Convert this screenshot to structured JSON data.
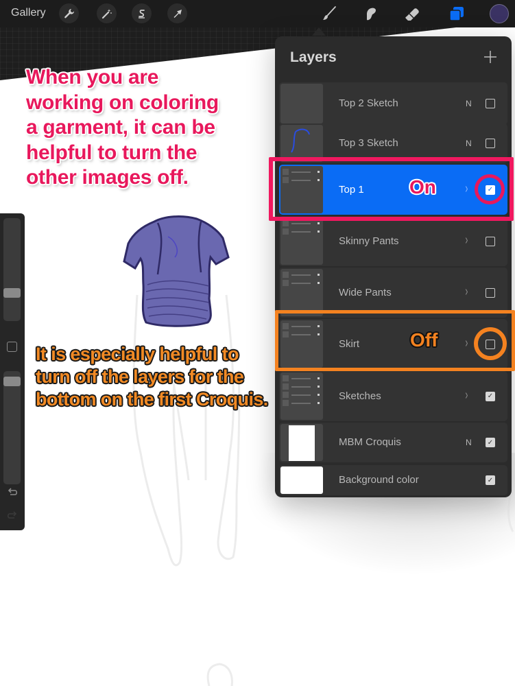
{
  "toolbar": {
    "gallery_label": "Gallery",
    "left_tools": [
      {
        "name": "actions",
        "icon": "wrench-icon"
      },
      {
        "name": "adjustments",
        "icon": "magic-wand-icon"
      },
      {
        "name": "selection",
        "icon": "selection-s-icon"
      },
      {
        "name": "transform",
        "icon": "arrow-cursor-icon"
      }
    ],
    "right_tools": [
      {
        "name": "brush",
        "icon": "brush-icon"
      },
      {
        "name": "smudge",
        "icon": "smudge-icon"
      },
      {
        "name": "eraser",
        "icon": "eraser-icon"
      },
      {
        "name": "layers",
        "icon": "layers-icon",
        "active": true
      }
    ],
    "active_color": "#3a3263",
    "accent_color": "#0a6cf5"
  },
  "sidebar": {
    "brush_size_level": 0.25,
    "opacity_level": 0.95
  },
  "layers_panel": {
    "title": "Layers",
    "add_label": "+",
    "layers": [
      {
        "name": "Top 2 Sketch",
        "blend": "N",
        "visible": false,
        "group": false,
        "selected": false
      },
      {
        "name": "Top 3 Sketch",
        "blend": "N",
        "visible": false,
        "group": false,
        "selected": false
      },
      {
        "name": "Top 1",
        "blend": "",
        "visible": true,
        "group": true,
        "selected": true
      },
      {
        "name": "Skinny Pants",
        "blend": "",
        "visible": false,
        "group": true,
        "selected": false
      },
      {
        "name": "Wide Pants",
        "blend": "",
        "visible": false,
        "group": true,
        "selected": false
      },
      {
        "name": "Skirt",
        "blend": "",
        "visible": false,
        "group": true,
        "selected": false
      },
      {
        "name": "Sketches",
        "blend": "",
        "visible": true,
        "group": true,
        "selected": false
      },
      {
        "name": "MBM Croquis",
        "blend": "N",
        "visible": true,
        "group": false,
        "selected": false
      },
      {
        "name": "Background color",
        "blend": "",
        "visible": true,
        "group": false,
        "selected": false
      }
    ]
  },
  "annotations": {
    "top_note": "When you are working on coloring a garment, it can be helpful to turn the other images off.",
    "bottom_note": "It is especially helpful to turn off the layers for the bottom on the first Croquis.",
    "on_label": "On",
    "off_label": "Off",
    "on_color": "#e8185c",
    "off_color": "#f48220"
  }
}
